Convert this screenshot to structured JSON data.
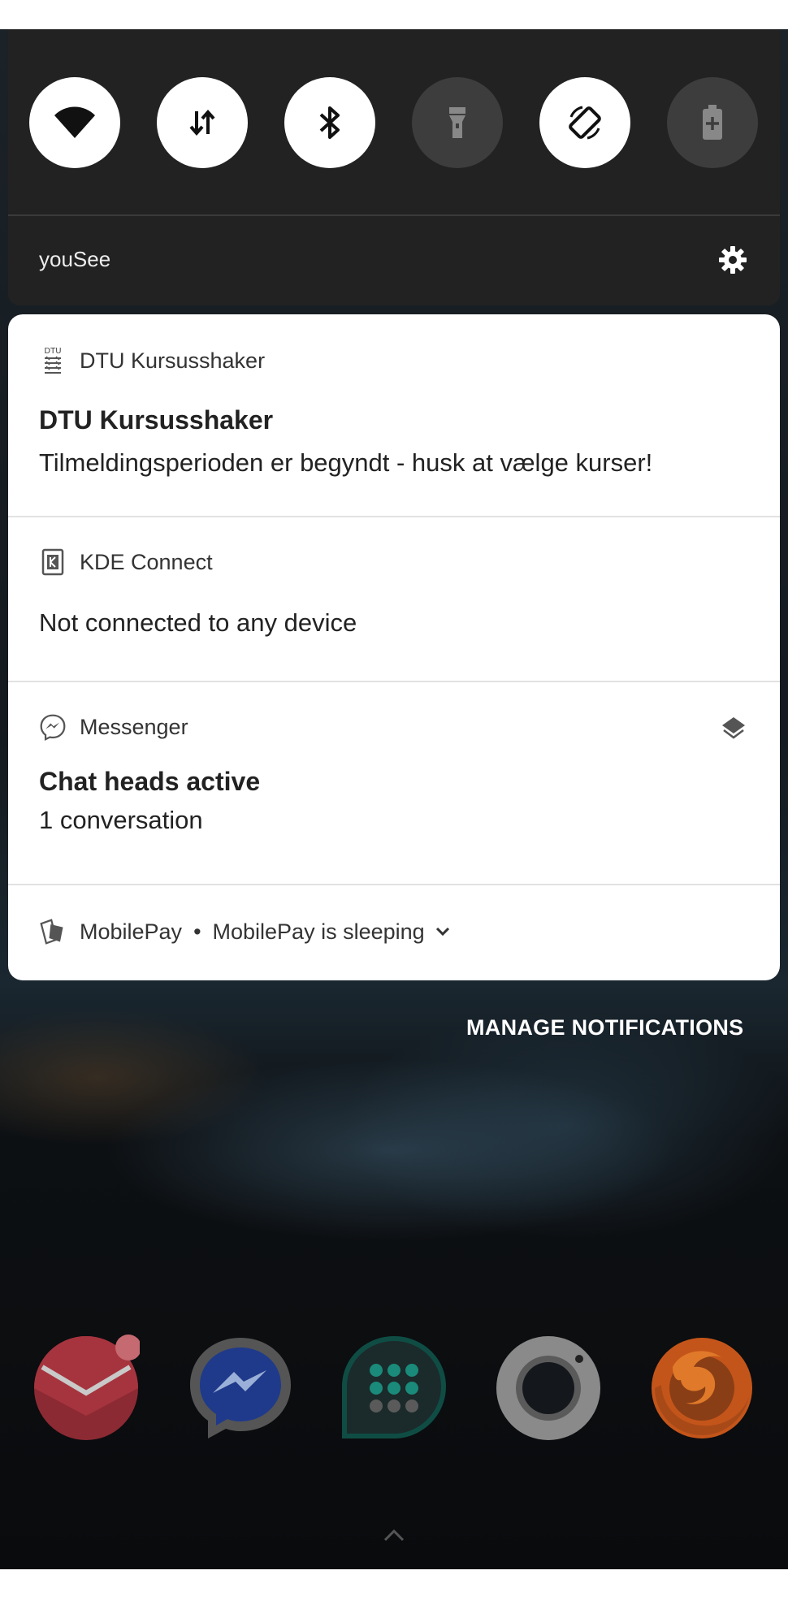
{
  "quick_settings": {
    "tiles": [
      {
        "name": "wifi",
        "icon": "wifi-icon",
        "active": true
      },
      {
        "name": "mobile-data",
        "icon": "data-arrows-icon",
        "active": true
      },
      {
        "name": "bluetooth",
        "icon": "bluetooth-icon",
        "active": true
      },
      {
        "name": "flashlight",
        "icon": "flashlight-icon",
        "active": false
      },
      {
        "name": "auto-rotate",
        "icon": "rotate-icon",
        "active": true
      },
      {
        "name": "battery-saver",
        "icon": "battery-icon",
        "active": false
      }
    ],
    "carrier": "youSee",
    "settings_icon": "gear-icon"
  },
  "notifications": [
    {
      "app": "DTU Kursusshaker",
      "icon": "dtu-logo-icon",
      "title": "DTU Kursusshaker",
      "text": "Tilmeldingsperioden er begyndt - husk at vælge kurser!"
    },
    {
      "app": "KDE Connect",
      "icon": "kde-connect-icon",
      "title": "",
      "text": "Not connected to any device"
    },
    {
      "app": "Messenger",
      "icon": "messenger-icon",
      "title": "Chat heads active",
      "text": "1 conversation",
      "extra_icon": "layers-icon"
    },
    {
      "app": "MobilePay",
      "icon": "mobilepay-icon",
      "separator": "•",
      "summary": "MobilePay is sleeping",
      "expand_icon": "chevron-down-icon"
    }
  ],
  "manage_notifications": "MANAGE NOTIFICATIONS",
  "dock": [
    {
      "name": "email",
      "icon": "email-app-icon",
      "color": "#c23a45"
    },
    {
      "name": "messenger",
      "icon": "messenger-app-icon",
      "color": "#1f3a8a"
    },
    {
      "name": "dialer",
      "icon": "dialer-app-icon",
      "color": "#1a8a7a"
    },
    {
      "name": "camera",
      "icon": "camera-app-icon",
      "color": "#9a9a9a"
    },
    {
      "name": "firefox",
      "icon": "firefox-app-icon",
      "color": "#d8631a"
    }
  ],
  "colors": {
    "panel": "#222222",
    "tile_on": "#ffffff",
    "tile_off": "#3d3d3d",
    "card": "#ffffff"
  }
}
